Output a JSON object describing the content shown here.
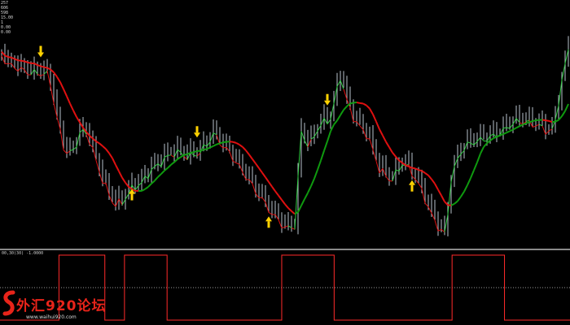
{
  "colors": {
    "background": "#000000",
    "price_bars": "#b9c2cc",
    "slow_ma_down": "#e01010",
    "slow_ma_up": "#0f9a0f",
    "fast_line": "#2ecc40",
    "arrow": "#ffd200",
    "indicator": "#ff2a2a",
    "logo_red": "#e8241a"
  },
  "info_panel": {
    "lines": [
      "257",
      "606",
      "598",
      "15.00",
      "1",
      "0.00",
      "0.00"
    ]
  },
  "indicator": {
    "label": "00,30(30) -1.0000",
    "states": [
      0,
      0,
      0,
      0,
      0,
      0,
      0,
      0,
      0,
      0,
      0,
      0,
      0,
      0,
      0,
      0,
      0,
      0,
      1,
      1,
      1,
      1,
      1,
      1,
      1,
      1,
      1,
      1,
      1,
      1,
      1,
      1,
      0,
      0,
      0,
      0,
      0,
      0,
      1,
      1,
      1,
      1,
      1,
      1,
      1,
      1,
      1,
      1,
      1,
      1,
      1,
      0,
      0,
      0,
      0,
      0,
      0,
      0,
      0,
      0,
      0,
      0,
      0,
      0,
      0,
      0,
      0,
      0,
      0,
      0,
      0,
      0,
      0,
      0,
      0,
      0,
      0,
      0,
      0,
      0,
      0,
      0,
      0,
      0,
      0,
      0,
      1,
      1,
      1,
      1,
      1,
      1,
      1,
      1,
      1,
      1,
      1,
      1,
      1,
      1,
      1,
      1,
      0,
      0,
      0,
      0,
      0,
      0,
      0,
      0,
      0,
      0,
      0,
      0,
      0,
      0,
      0,
      0,
      0,
      0,
      0,
      0,
      0,
      0,
      0,
      0,
      0,
      0,
      0,
      0,
      0,
      0,
      0,
      0,
      0,
      0,
      0,
      0,
      1,
      1,
      1,
      1,
      1,
      1,
      1,
      1,
      1,
      1,
      1,
      1,
      1,
      1,
      1,
      1,
      0,
      0,
      0,
      0,
      0,
      0,
      0,
      0,
      0,
      0,
      0,
      0,
      0,
      0,
      0,
      0,
      0,
      0,
      0,
      0
    ]
  },
  "arrows": [
    {
      "direction": "down",
      "bar": 12
    },
    {
      "direction": "up",
      "bar": 40
    },
    {
      "direction": "down",
      "bar": 60
    },
    {
      "direction": "up",
      "bar": 82
    },
    {
      "direction": "down",
      "bar": 100
    },
    {
      "direction": "up",
      "bar": 126
    }
  ],
  "logo": {
    "title": "外汇920论坛",
    "url": "www.waihui920.com"
  }
}
